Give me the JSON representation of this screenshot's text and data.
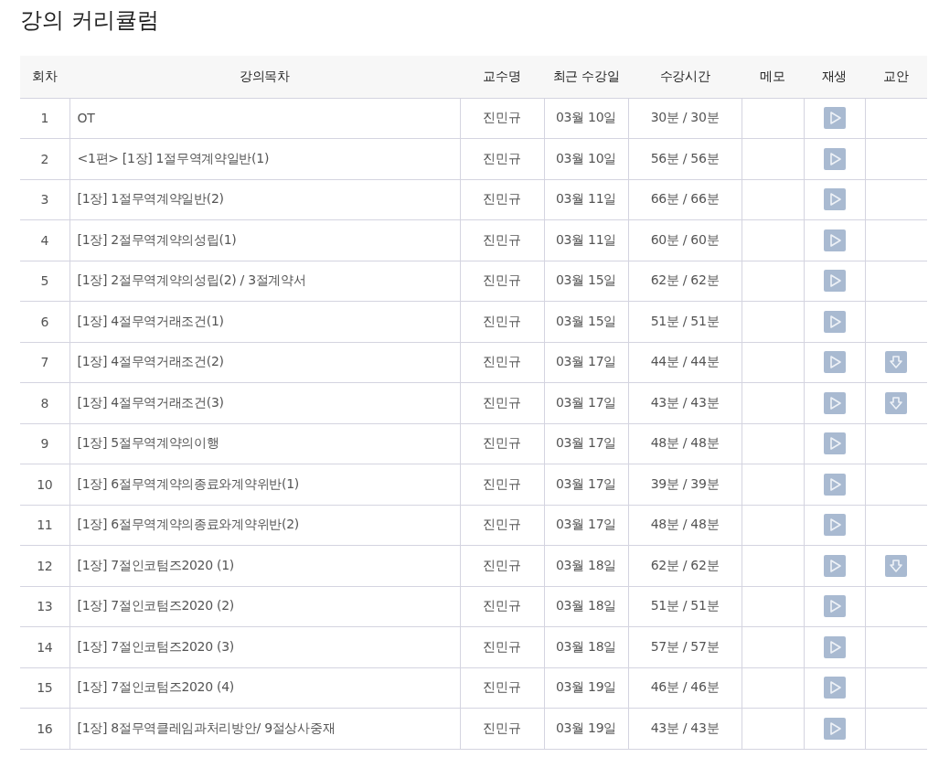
{
  "page_title": "강의 커리큘럼",
  "table": {
    "columns": [
      "회차",
      "강의목차",
      "교수명",
      "최근 수강일",
      "수강시간",
      "메모",
      "재생",
      "교안"
    ],
    "rows": [
      {
        "no": "1",
        "title": "OT",
        "professor": "진민규",
        "last_date": "03월 10일",
        "watch_time": "30분 / 30분",
        "handout": false
      },
      {
        "no": "2",
        "title": "<1편> [1장] 1절무역계약일반(1)",
        "professor": "진민규",
        "last_date": "03월 10일",
        "watch_time": "56분 / 56분",
        "handout": false
      },
      {
        "no": "3",
        "title": "[1장] 1절무역계약일반(2)",
        "professor": "진민규",
        "last_date": "03월 11일",
        "watch_time": "66분 / 66분",
        "handout": false
      },
      {
        "no": "4",
        "title": "[1장] 2절무역계약의성립(1)",
        "professor": "진민규",
        "last_date": "03월 11일",
        "watch_time": "60분 / 60분",
        "handout": false
      },
      {
        "no": "5",
        "title": "[1장] 2절무역계약의성립(2) / 3절계약서",
        "professor": "진민규",
        "last_date": "03월 15일",
        "watch_time": "62분 / 62분",
        "handout": false
      },
      {
        "no": "6",
        "title": "[1장] 4절무역거래조건(1)",
        "professor": "진민규",
        "last_date": "03월 15일",
        "watch_time": "51분 / 51분",
        "handout": false
      },
      {
        "no": "7",
        "title": "[1장] 4절무역거래조건(2)",
        "professor": "진민규",
        "last_date": "03월 17일",
        "watch_time": "44분 / 44분",
        "handout": true
      },
      {
        "no": "8",
        "title": "[1장] 4절무역거래조건(3)",
        "professor": "진민규",
        "last_date": "03월 17일",
        "watch_time": "43분 / 43분",
        "handout": true
      },
      {
        "no": "9",
        "title": "[1장] 5절무역계약의이행",
        "professor": "진민규",
        "last_date": "03월 17일",
        "watch_time": "48분 / 48분",
        "handout": false
      },
      {
        "no": "10",
        "title": "[1장] 6절무역계약의종료와계약위반(1)",
        "professor": "진민규",
        "last_date": "03월 17일",
        "watch_time": "39분 / 39분",
        "handout": false
      },
      {
        "no": "11",
        "title": "[1장] 6절무역계약의종료와계약위반(2)",
        "professor": "진민규",
        "last_date": "03월 17일",
        "watch_time": "48분 / 48분",
        "handout": false
      },
      {
        "no": "12",
        "title": "[1장] 7절인코텀즈2020 (1)",
        "professor": "진민규",
        "last_date": "03월 18일",
        "watch_time": "62분 / 62분",
        "handout": true
      },
      {
        "no": "13",
        "title": "[1장] 7절인코텀즈2020 (2)",
        "professor": "진민규",
        "last_date": "03월 18일",
        "watch_time": "51분 / 51분",
        "handout": false
      },
      {
        "no": "14",
        "title": "[1장] 7절인코텀즈2020 (3)",
        "professor": "진민규",
        "last_date": "03월 18일",
        "watch_time": "57분 / 57분",
        "handout": false
      },
      {
        "no": "15",
        "title": "[1장] 7절인코텀즈2020 (4)",
        "professor": "진민규",
        "last_date": "03월 19일",
        "watch_time": "46분 / 46분",
        "handout": false
      },
      {
        "no": "16",
        "title": "[1장] 8절무역클레임과처리방안/ 9절상사중재",
        "professor": "진민규",
        "last_date": "03월 19일",
        "watch_time": "43분 / 43분",
        "handout": false
      }
    ]
  }
}
